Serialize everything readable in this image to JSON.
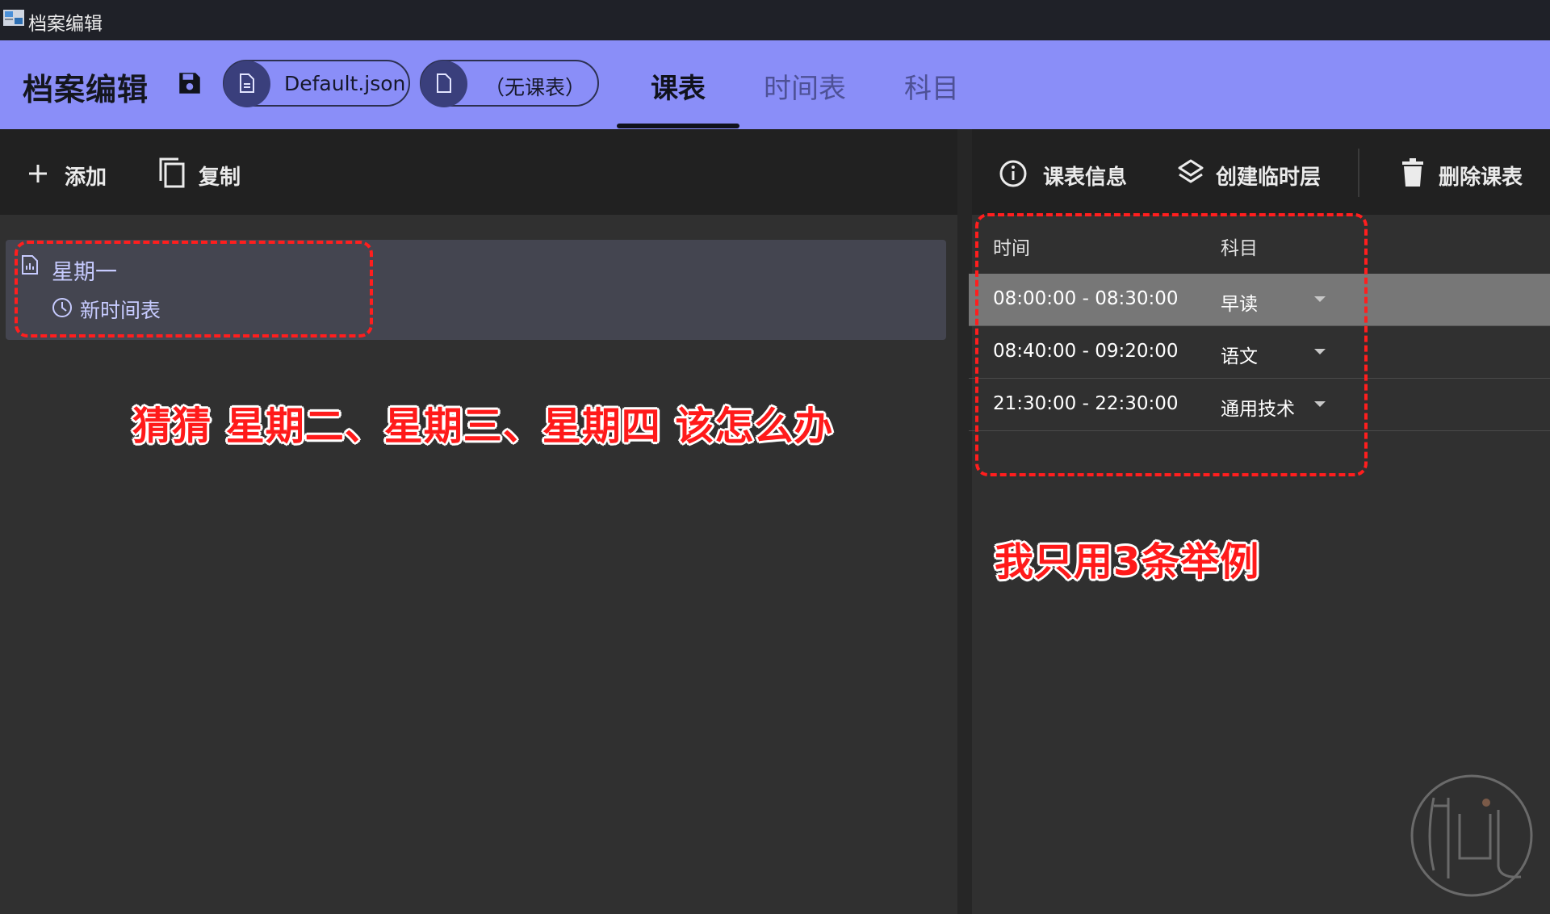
{
  "window": {
    "title": "档案编辑"
  },
  "appbar": {
    "title": "档案编辑",
    "profile_file": "Default.json",
    "classplan_chip": "（无课表）",
    "tabs": [
      {
        "label": "课表",
        "active": true
      },
      {
        "label": "时间表",
        "active": false
      },
      {
        "label": "科目",
        "active": false
      }
    ]
  },
  "left_toolbar": {
    "add_label": "添加",
    "copy_label": "复制"
  },
  "right_toolbar": {
    "info_label": "课表信息",
    "temp_layer_label": "创建临时层",
    "delete_label": "删除课表"
  },
  "class_plans": [
    {
      "name": "星期一",
      "timetable": "新时间表"
    }
  ],
  "grid": {
    "columns": {
      "time": "时间",
      "subject": "科目"
    },
    "rows": [
      {
        "time": "08:00:00 - 08:30:00",
        "subject": "早读"
      },
      {
        "time": "08:40:00 - 09:20:00",
        "subject": "语文"
      },
      {
        "time": "21:30:00 - 22:30:00",
        "subject": "通用技术"
      }
    ]
  },
  "annotations": {
    "left_note": "猜猜 星期二、星期三、星期四 该怎么办",
    "right_note": "我只用3条举例"
  },
  "colors": {
    "appbar": "#8a8ef8",
    "annotation": "#ff1a1a",
    "background": "#303030"
  }
}
